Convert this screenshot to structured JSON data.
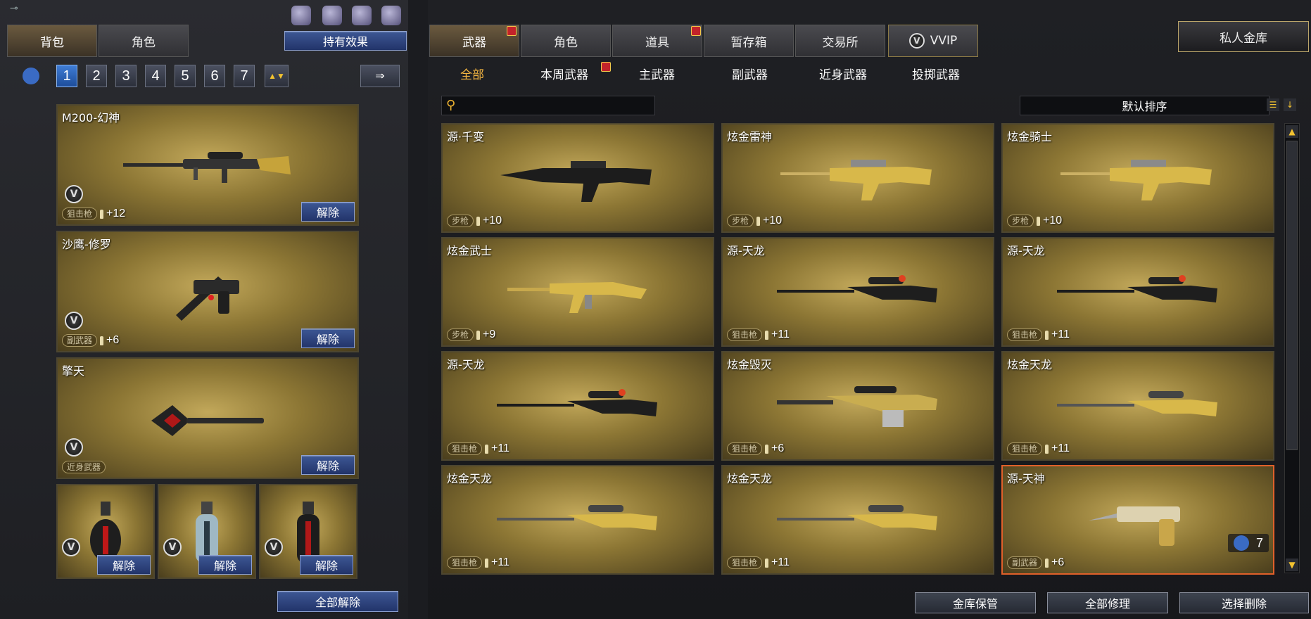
{
  "left": {
    "tabs": [
      {
        "label": "背包"
      },
      {
        "label": "角色"
      }
    ],
    "effects_button": "持有效果",
    "pages": [
      "1",
      "2",
      "3",
      "4",
      "5",
      "6",
      "7"
    ],
    "active_page": "1",
    "equipped": [
      {
        "name": "M200-幻神",
        "type": "狙击枪",
        "plus": "+12",
        "release": "解除"
      },
      {
        "name": "沙鹰-修罗",
        "type": "副武器",
        "plus": "+6",
        "release": "解除"
      },
      {
        "name": "擎天",
        "type": "近身武器",
        "plus": "",
        "release": "解除"
      }
    ],
    "grenades": [
      {
        "release": "解除"
      },
      {
        "release": "解除"
      },
      {
        "release": "解除"
      }
    ],
    "release_all": "全部解除"
  },
  "right": {
    "tabs": [
      {
        "label": "武器",
        "gift": true
      },
      {
        "label": "角色",
        "gift": false
      },
      {
        "label": "道具",
        "gift": true
      },
      {
        "label": "暂存箱",
        "gift": false
      },
      {
        "label": "交易所",
        "gift": false
      },
      {
        "label": "VVIP",
        "gift": false
      }
    ],
    "vault_button": "私人金库",
    "subtabs": [
      {
        "label": "全部",
        "gift": false
      },
      {
        "label": "本周武器",
        "gift": true
      },
      {
        "label": "主武器",
        "gift": false
      },
      {
        "label": "副武器",
        "gift": false
      },
      {
        "label": "近身武器",
        "gift": false
      },
      {
        "label": "投掷武器",
        "gift": false
      }
    ],
    "active_subtab": "全部",
    "sort_label": "默认排序",
    "items": [
      {
        "name": "源·千变",
        "type": "步枪",
        "plus": "+10",
        "gun": "rifle-dark"
      },
      {
        "name": "炫金雷神",
        "type": "步枪",
        "plus": "+10",
        "gun": "rifle-gold"
      },
      {
        "name": "炫金骑士",
        "type": "步枪",
        "plus": "+10",
        "gun": "rifle-gold"
      },
      {
        "name": "炫金武士",
        "type": "步枪",
        "plus": "+9",
        "gun": "ak-gold"
      },
      {
        "name": "源-天龙",
        "type": "狙击枪",
        "plus": "+11",
        "gun": "sniper-dark"
      },
      {
        "name": "源-天龙",
        "type": "狙击枪",
        "plus": "+11",
        "gun": "sniper-dark"
      },
      {
        "name": "源-天龙",
        "type": "狙击枪",
        "plus": "+11",
        "gun": "sniper-dark"
      },
      {
        "name": "炫金毁灭",
        "type": "狙击枪",
        "plus": "+6",
        "gun": "heavy-sniper"
      },
      {
        "name": "炫金天龙",
        "type": "狙击枪",
        "plus": "+11",
        "gun": "sniper-gold"
      },
      {
        "name": "炫金天龙",
        "type": "狙击枪",
        "plus": "+11",
        "gun": "sniper-gold"
      },
      {
        "name": "炫金天龙",
        "type": "狙击枪",
        "plus": "+11",
        "gun": "sniper-gold"
      },
      {
        "name": "源-天神",
        "type": "副武器",
        "plus": "+6",
        "gun": "pistol-gold",
        "count": "7",
        "selected": true
      }
    ],
    "bottom_buttons": [
      {
        "label": "金库保管"
      },
      {
        "label": "全部修理"
      },
      {
        "label": "选择删除"
      }
    ]
  },
  "colors": {
    "accent_gold": "#f4b642",
    "card_bg": "#8c7634",
    "blue_button": "#2d4680",
    "selected_border": "#e0602a"
  }
}
